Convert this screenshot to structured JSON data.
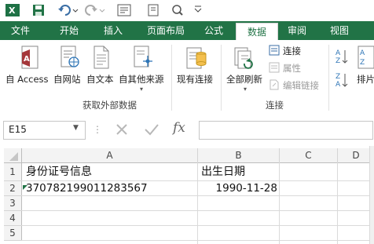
{
  "app": {
    "logo_letter": "X"
  },
  "qat": {
    "icons": [
      "save-icon",
      "undo-icon",
      "redo-icon",
      "form-icon",
      "print-preview-icon",
      "more-icon"
    ]
  },
  "tabs": [
    "文件",
    "开始",
    "插入",
    "页面布局",
    "公式",
    "数据",
    "审阅",
    "视图"
  ],
  "active_tab": "数据",
  "ribbon": {
    "external_data": {
      "items": [
        "自 Access",
        "自网站",
        "自文本",
        "自其他来源"
      ],
      "group": "获取外部数据"
    },
    "existing": "现有连接",
    "connections": {
      "refresh_all": "全部刷新",
      "connect": "连接",
      "properties": "属性",
      "edit_links": "编辑链接",
      "group": "连接"
    },
    "sort_partial": "排片"
  },
  "formula_bar": {
    "name_box": "E15",
    "fx": "fx",
    "value": ""
  },
  "sheet": {
    "columns": [
      "A",
      "B",
      "C",
      "D"
    ],
    "rows": [
      "1",
      "2",
      "3",
      "4",
      "5"
    ],
    "cells": {
      "A1": "身份证号信息",
      "B1": "出生日期",
      "A2": "370782199011283567",
      "B2": "1990-11-28"
    }
  },
  "colors": {
    "brand": "#217346",
    "ribbon_bg": "#ffffff",
    "grid_line": "#dadada"
  }
}
